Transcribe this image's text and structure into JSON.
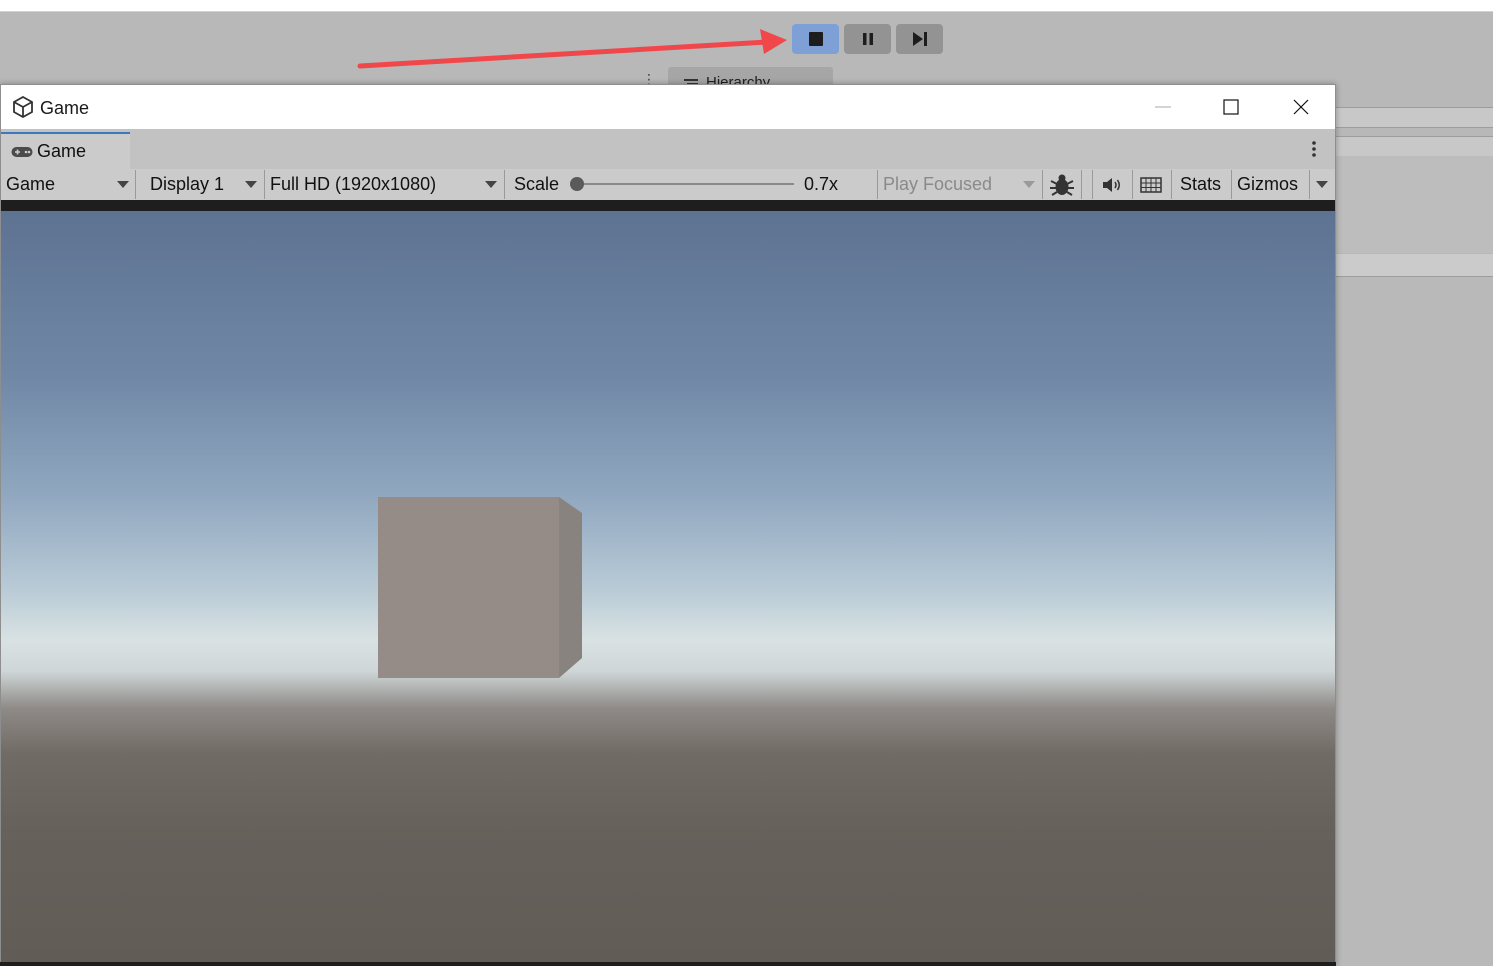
{
  "toolbar_buttons": {
    "stop_icon": "stop-icon",
    "pause_icon": "pause-icon",
    "step_icon": "step-icon",
    "stop_active_color": "#7ea0d6"
  },
  "hierarchy_tab": {
    "label": "Hierarchy"
  },
  "game_window": {
    "title": "Game",
    "tab_label": "Game",
    "controls": [
      "minimize",
      "maximize",
      "close"
    ]
  },
  "game_toolbar": {
    "view_mode": "Game",
    "display": "Display 1",
    "resolution": "Full HD (1920x1080)",
    "scale_label": "Scale",
    "scale_value": "0.7x",
    "scale_fraction": 0.0,
    "play_mode": "Play Focused",
    "stats_label": "Stats",
    "gizmos_label": "Gizmos"
  },
  "scene": {
    "sky_top_color": "#5e7292",
    "horizon_color": "#d9e2e3",
    "ground_color": "#625c57",
    "cube_color": "#958c88"
  },
  "annotation": {
    "arrow_color": "#f0474b",
    "points_to": "stop-button"
  }
}
